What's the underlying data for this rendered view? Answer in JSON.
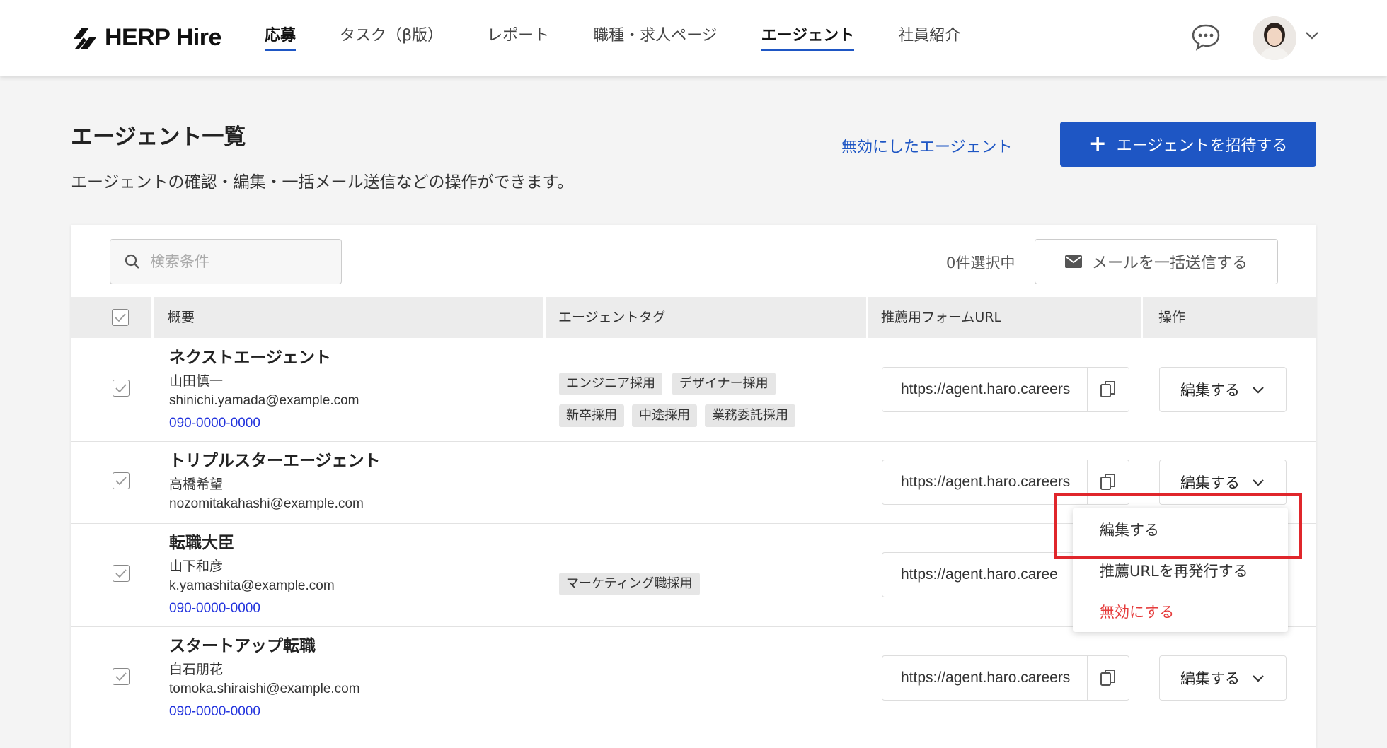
{
  "header": {
    "logo_text": "HERP Hire",
    "nav": [
      {
        "label": "応募"
      },
      {
        "label": "タスク（β版）"
      },
      {
        "label": "レポート"
      },
      {
        "label": "職種・求人ページ"
      },
      {
        "label": "エージェント"
      },
      {
        "label": "社員紹介"
      }
    ]
  },
  "page": {
    "title": "エージェント一覧",
    "description": "エージェントの確認・編集・一括メール送信などの操作ができます。",
    "disabled_agents_link": "無効にしたエージェント",
    "invite_button": "エージェントを招待する",
    "invite_plus": "+"
  },
  "toolbar": {
    "search_placeholder": "検索条件",
    "selected_count": "0件選択中",
    "bulk_mail_button": "メールを一括送信する"
  },
  "table": {
    "columns": [
      "概要",
      "エージェントタグ",
      "推薦用フォームURL",
      "操作"
    ],
    "rows": [
      {
        "name": "ネクストエージェント",
        "person": "山田慎一",
        "email": "shinichi.yamada@example.com",
        "phone": "090-0000-0000",
        "tags": [
          "エンジニア採用",
          "デザイナー採用",
          "新卒採用",
          "中途採用",
          "業務委託採用"
        ],
        "url": "https://agent.haro.careers",
        "action": "編集する"
      },
      {
        "name": "トリプルスターエージェント",
        "person": "高橋希望",
        "email": "nozomitakahashi@example.com",
        "phone": "",
        "tags": [],
        "url": "https://agent.haro.careers",
        "action": "編集する"
      },
      {
        "name": "転職大臣",
        "person": "山下和彦",
        "email": "k.yamashita@example.com",
        "phone": "090-0000-0000",
        "tags": [
          "マーケティング職採用"
        ],
        "url": "https://agent.haro.caree",
        "action": ""
      },
      {
        "name": "スタートアップ転職",
        "person": "白石朋花",
        "email": "tomoka.shiraishi@example.com",
        "phone": "090-0000-0000",
        "tags": [],
        "url": "https://agent.haro.careers",
        "action": "編集する"
      }
    ]
  },
  "dropdown": {
    "items": [
      "編集する",
      "推薦URLを再発行する",
      "無効にする"
    ]
  },
  "colors": {
    "primary": "#1e56c4",
    "danger": "#e53b3b",
    "highlight": "#e0262b",
    "link_phone": "#2233dd"
  }
}
